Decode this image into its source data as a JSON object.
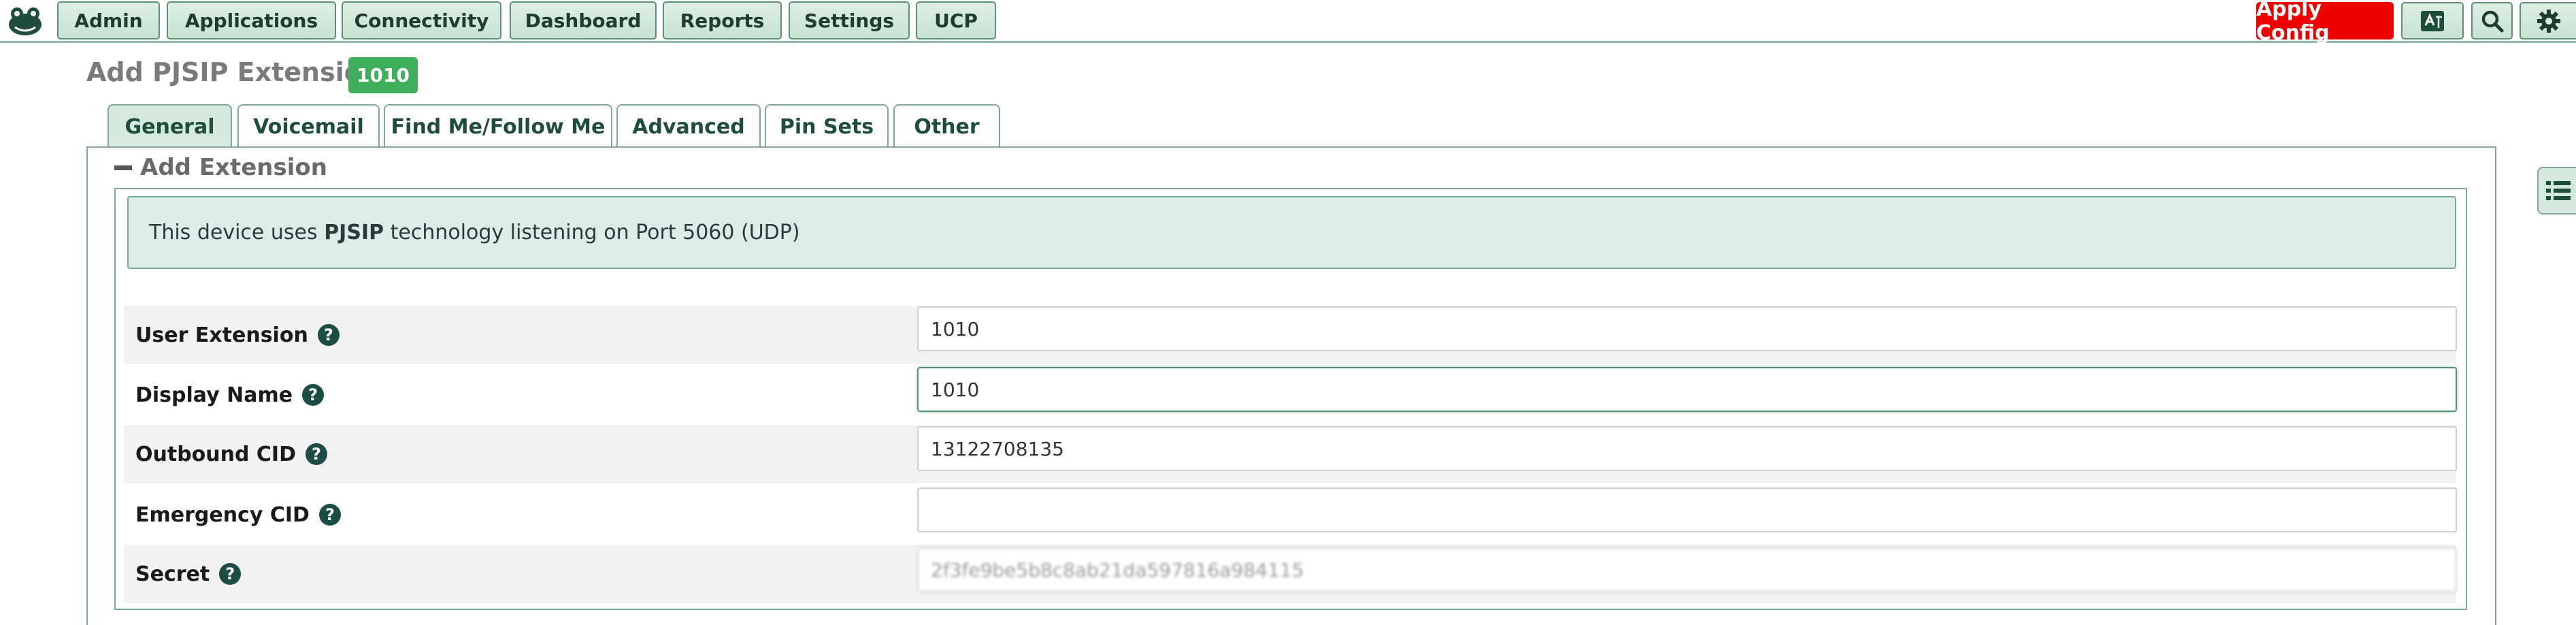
{
  "nav": {
    "items": [
      "Admin",
      "Applications",
      "Connectivity",
      "Dashboard",
      "Reports",
      "Settings",
      "UCP"
    ],
    "apply_label": "Apply Config",
    "icons": [
      "translate-icon",
      "search-icon",
      "gear-icon"
    ]
  },
  "page": {
    "title": "Add PJSIP Extension",
    "badge": "1010"
  },
  "tabs": [
    "General",
    "Voicemail",
    "Find Me/Follow Me",
    "Advanced",
    "Pin Sets",
    "Other"
  ],
  "section": {
    "title": "Add Extension",
    "info_prefix": "This device uses ",
    "info_tech": "PJSIP",
    "info_suffix": " technology listening on Port 5060 (UDP)"
  },
  "fields": [
    {
      "label": "User Extension",
      "value": "1010"
    },
    {
      "label": "Display Name",
      "value": "1010"
    },
    {
      "label": "Outbound CID",
      "value": "13122708135"
    },
    {
      "label": "Emergency CID",
      "value": ""
    },
    {
      "label": "Secret",
      "value": "2f3fe9be5b8c8ab21da597816a984115"
    }
  ],
  "colors": {
    "accent": "#3fae5a",
    "apply": "#ee0000",
    "nav_border": "#5e8f78",
    "help": "#1c4d44"
  }
}
